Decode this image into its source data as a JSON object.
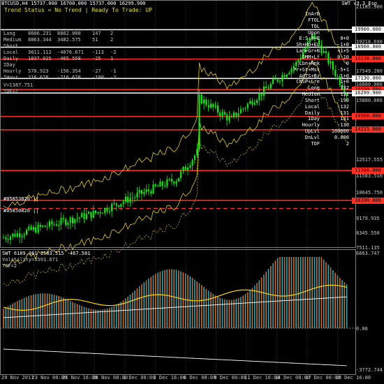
{
  "header": {
    "title": "BTCUSD,H4  15737.000 16700.000 15737.000 16299.900",
    "indicator_name": "SWT v3.3_Esp",
    "trend_status": "Trend Status = No Trend  |  Ready To Trade: UP"
  },
  "left_table": [
    {
      "label": "Long",
      "v1": "8606.231",
      "v2": "8862.000",
      "v3": "147",
      "v4": "2"
    },
    {
      "label": "Medium",
      "v1": "8863.344",
      "v2": "3482.575",
      "v3": "51",
      "v4": "2"
    },
    {
      "label": "Short",
      "v1": "",
      "v2": "",
      "v3": "",
      "v4": ""
    },
    {
      "label": "Local",
      "v1": "3611.112",
      "v2": "-4076.671",
      "v3": "-113",
      "v4": "-2"
    },
    {
      "label": "Daily",
      "v1": "1837.925",
      "v2": "-465.558",
      "v3": "-25",
      "v4": "1"
    },
    {
      "label": "IDay",
      "v1": "",
      "v2": "",
      "v3": "",
      "v4": ""
    },
    {
      "label": "Hourly",
      "v1": "570.923",
      "v2": "-156.354",
      "v3": "-27",
      "v4": "-1"
    },
    {
      "label": "IHour",
      "v1": "216.628",
      "v2": "-216.628",
      "v3": "-100",
      "v4": "-2"
    }
  ],
  "left_extra": [
    "V=1387.751",
    "TOF=2"
  ],
  "right_table": [
    {
      "label": "InArB",
      "value": ""
    },
    {
      "label": "FTOL",
      "value": ""
    },
    {
      "label": "TOL",
      "value": ""
    },
    {
      "label": "Upon",
      "value": ""
    },
    {
      "label": "E:S:H+E",
      "value": "0+0"
    },
    {
      "label": "Sh+HO+EL",
      "value": "-1+0"
    },
    {
      "label": "Lan+Gr+N",
      "value": "+1+5"
    },
    {
      "label": "DMM+Lf",
      "value": "0-10"
    },
    {
      "label": "Lbn+Rnk",
      "value": "0"
    },
    {
      "label": "Pr+St+Mst",
      "value": "-5+1"
    },
    {
      "label": "AdTS+Bz",
      "value": "1+0"
    },
    {
      "label": "CNSP+Lre",
      "value": "1+0"
    },
    {
      "label": "Long",
      "value": "132"
    },
    {
      "label": "Medium",
      "value": "132"
    },
    {
      "label": "Short",
      "value": "-190"
    },
    {
      "label": "Local",
      "value": "-132"
    },
    {
      "label": "Daily",
      "value": "131"
    },
    {
      "label": "IDay",
      "value": "131"
    },
    {
      "label": "Hourly",
      "value": "-130"
    },
    {
      "label": "UpLvl",
      "value": "100000"
    },
    {
      "label": "DnLvl",
      "value": "0.000"
    },
    {
      "label": "TOF",
      "value": "2"
    }
  ],
  "price_axis": [
    "21185.900",
    "19900.000",
    "19218.690",
    "18900.000",
    "18230.000",
    "17549.280",
    "17130.000",
    "16800.000",
    "16299.900",
    "15880.000",
    "14966.000",
    "14215.000",
    "12517.555",
    "11900.000",
    "11583.510",
    "10645.750",
    "10200.000",
    "9179.935",
    "8345.550",
    "7511.135"
  ],
  "levels": [
    {
      "label": "19900.000",
      "color": "#ffffff"
    },
    {
      "label": "18900.000",
      "color": "#ffffff"
    },
    {
      "label": "18230.000",
      "color": "#ff3020"
    },
    {
      "label": "17130.000",
      "color": "#ffffff"
    },
    {
      "label": "16500.000",
      "color": "#ff3020"
    },
    {
      "label": "16299.900",
      "color": "#ffffff"
    },
    {
      "label": "14966.000",
      "color": "#ff3020"
    },
    {
      "label": "14215.000",
      "color": "#ff3020"
    },
    {
      "label": "11900.000",
      "color": "#ff3020"
    },
    {
      "label": "10200.000",
      "color": "#ff3020"
    }
  ],
  "left_markers": [
    "#05853820 ||",
    "#05850820 ||"
  ],
  "sub_window": {
    "title": "SWT 6189.361 3583.515 -467.581",
    "line2": "Volatility=5591.671",
    "line3": "TOF=2",
    "axis": [
      "6663.747",
      "0.00",
      "-3772.744"
    ]
  },
  "time_axis": [
    "20 Nov 2017",
    "23 Nov 00:00",
    "25 Nov 16:00",
    "28 Nov 08:00",
    "1 Dec 00:00",
    "3 Dec 16:00",
    "6 Dec 08:00",
    "9 Dec 00:00",
    "11 Dec 16:00",
    "14 Dec 08:00",
    "17 Dec 00:00",
    "19 Dec 16:00"
  ],
  "colors": {
    "candle": "#00ff00",
    "yellow_line": "#e6d200",
    "red_level": "#ff3020",
    "white_level": "#ffffff",
    "histo_teal": "#2aa9b8",
    "histo_orange": "#d96a1e"
  }
}
